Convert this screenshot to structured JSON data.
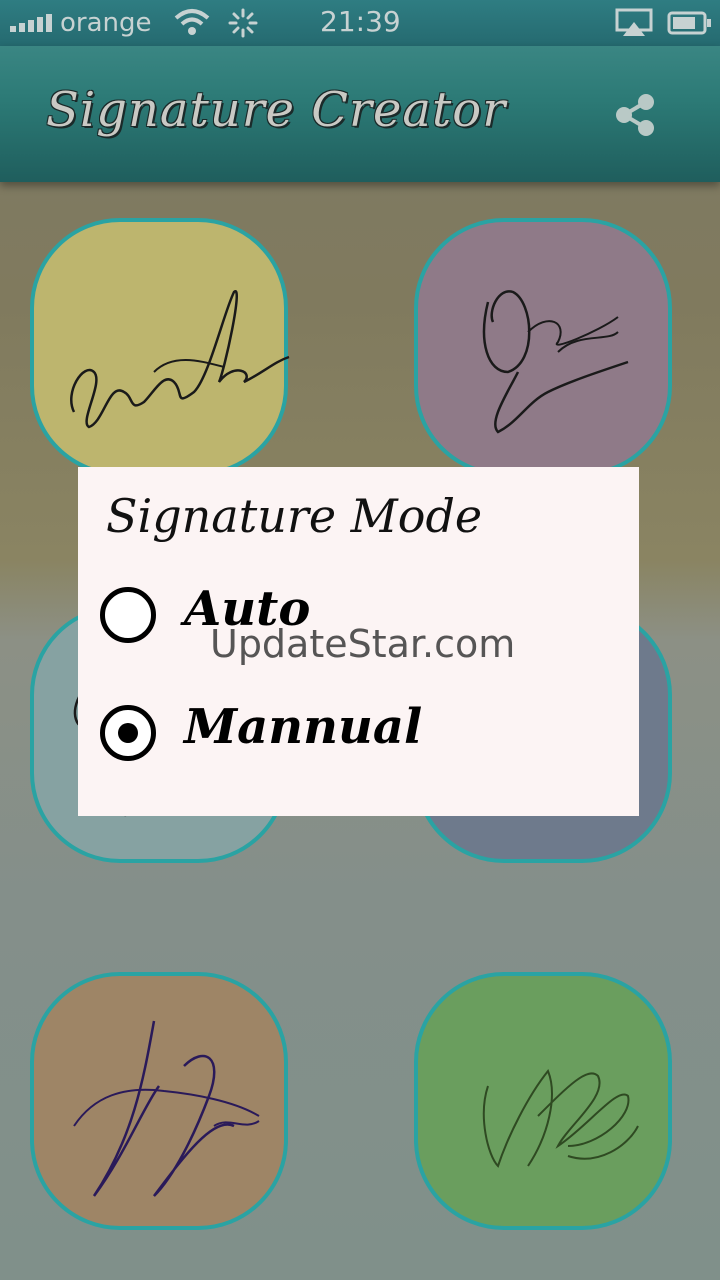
{
  "status_bar": {
    "carrier": "orange",
    "time": "21:39"
  },
  "app_bar": {
    "title": "Signature Creator",
    "share_icon": "share-icon"
  },
  "tiles": [
    {
      "name": "signature-tile-1",
      "color": "#bdb56e"
    },
    {
      "name": "signature-tile-2",
      "color": "#8f7a88"
    },
    {
      "name": "signature-tile-3",
      "color": "#86a2a2"
    },
    {
      "name": "signature-tile-4",
      "color": "#6e7a8c"
    },
    {
      "name": "signature-tile-5",
      "color": "#9e8566"
    },
    {
      "name": "signature-tile-6",
      "color": "#6a9e5e"
    }
  ],
  "dialog": {
    "title": "Signature Mode",
    "options": [
      {
        "label": "Auto",
        "selected": false
      },
      {
        "label": "Mannual",
        "selected": true
      }
    ]
  },
  "watermark": "UpdateStar.com"
}
